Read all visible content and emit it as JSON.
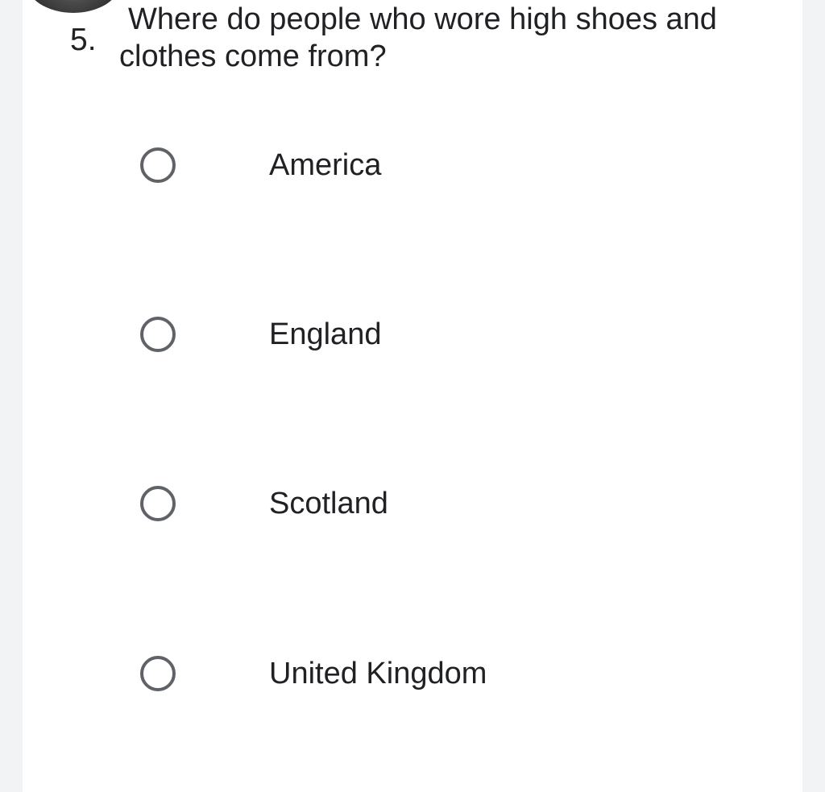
{
  "question": {
    "number": "5.",
    "text": "Where do people who wore high shoes and clothes come from?"
  },
  "options": [
    {
      "label": "America",
      "selected": false
    },
    {
      "label": "England",
      "selected": false
    },
    {
      "label": "Scotland",
      "selected": false
    },
    {
      "label": "United Kingdom",
      "selected": false
    }
  ],
  "colors": {
    "page_background": "#f1f3f4",
    "card_background": "#ffffff",
    "text": "#202124",
    "radio_border": "#5f6368"
  }
}
